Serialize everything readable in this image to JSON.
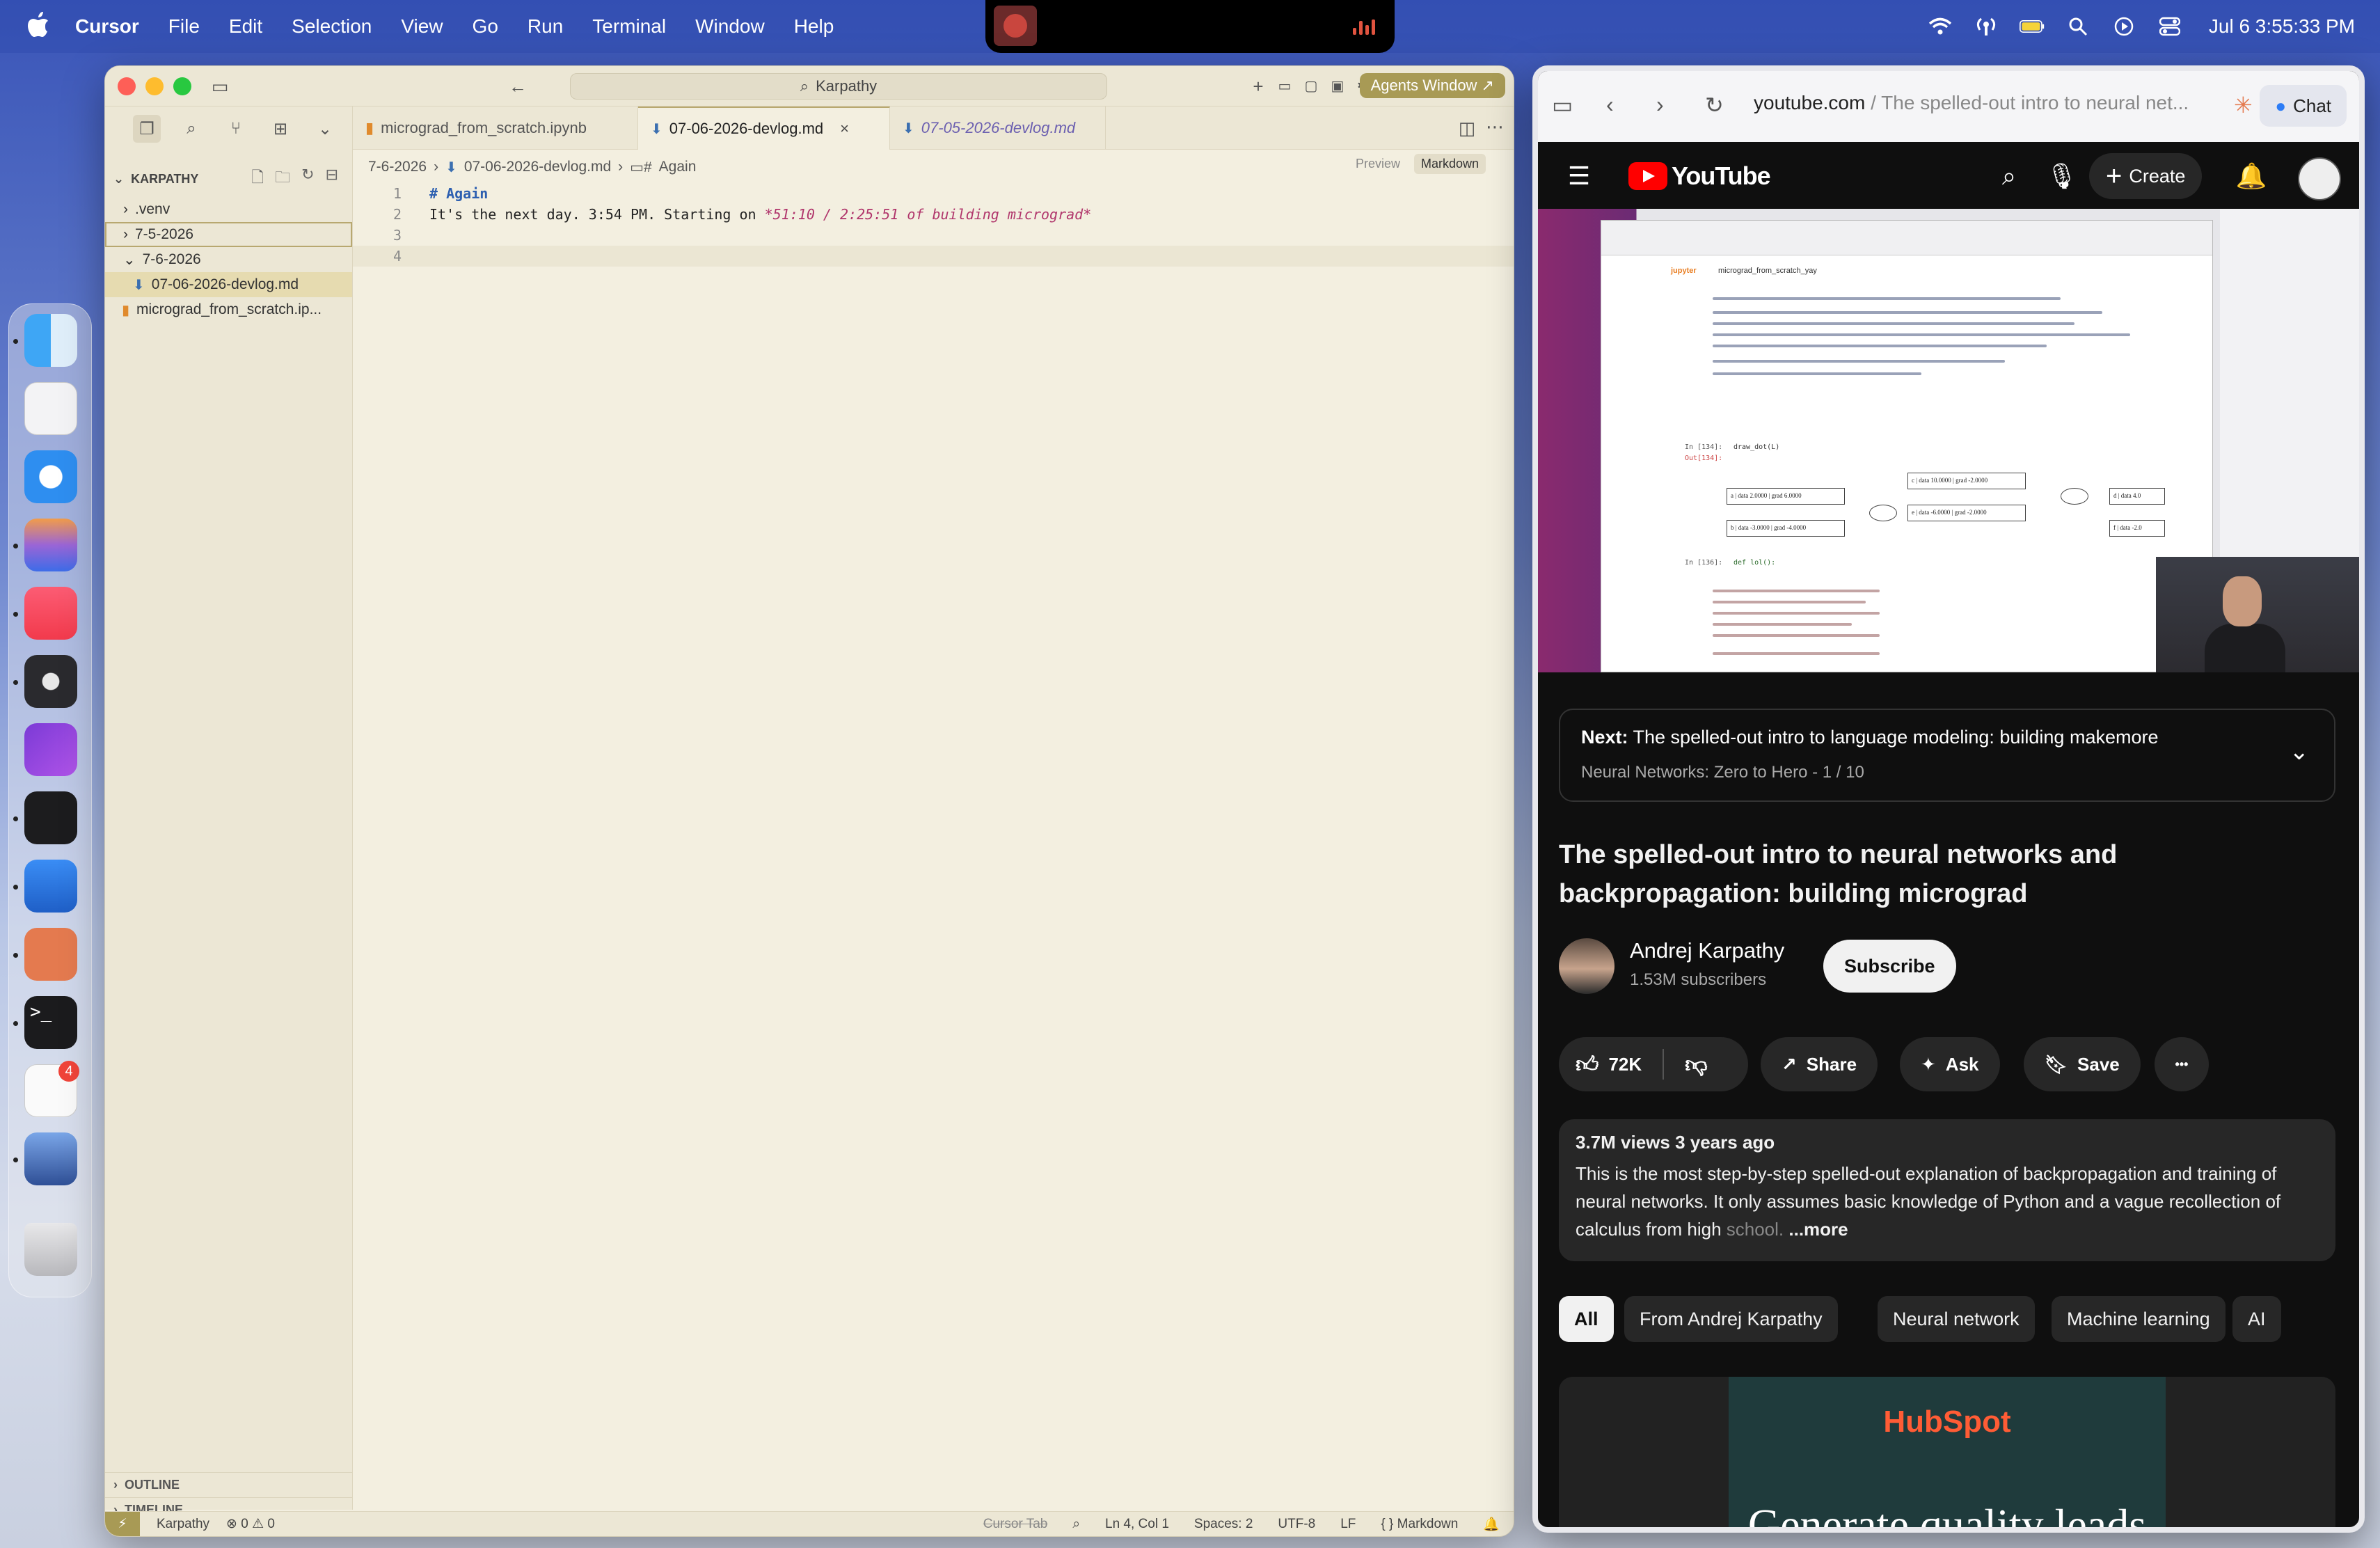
{
  "menubar": {
    "apple_icon": "apple-logo-icon",
    "items": [
      "Cursor",
      "File",
      "Edit",
      "Selection",
      "View",
      "Go",
      "Run",
      "Terminal",
      "Window",
      "Help"
    ],
    "clock": "Jul 6  3:55:33 PM",
    "status_icons": [
      "wifi-icon",
      "airdrop-icon",
      "battery-icon",
      "search-icon",
      "screen-record-icon",
      "control-center-icon"
    ]
  },
  "dock": {
    "apps": [
      "Finder",
      "Launchpad",
      "Safari",
      "Arc",
      "Music",
      "DaVinci Resolve",
      "Affinity Photo",
      "Cursor",
      "Xcode",
      "Claude",
      "Terminal",
      "Reminders",
      "Backup",
      "Trash"
    ],
    "reminders_badge": "4"
  },
  "editor": {
    "search_text": "Karpathy",
    "agents_label": "Agents Window ↗",
    "explorer": {
      "title": "KARPATHY",
      "rows": [
        {
          "label": ".venv",
          "chevron": "›"
        },
        {
          "label": "7-5-2026",
          "chevron": "›"
        },
        {
          "label": "7-6-2026",
          "chevron": "⌄"
        },
        {
          "label": "07-06-2026-devlog.md",
          "chevron": ""
        },
        {
          "label": "micrograd_from_scratch.ip...",
          "chevron": ""
        }
      ],
      "outline": "OUTLINE",
      "timeline": "TIMELINE"
    },
    "tabs": [
      {
        "label": "micrograd_from_scratch.ipynb"
      },
      {
        "label": "07-06-2026-devlog.md",
        "close": "×"
      },
      {
        "label": "07-05-2026-devlog.md"
      }
    ],
    "breadcrumb": {
      "folder": "7-6-2026",
      "file": "07-06-2026-devlog.md",
      "section": "Again"
    },
    "view_modes": {
      "preview": "Preview",
      "markdown": "Markdown"
    },
    "lines": [
      {
        "num": "1",
        "heading": "# Again"
      },
      {
        "num": "2",
        "plain": "It's the next day. 3:54 PM. Starting on ",
        "emph": "*51:10 / 2:25:51 of building micrograd*"
      },
      {
        "num": "3"
      },
      {
        "num": "4"
      }
    ],
    "status": {
      "workspace": "Karpathy",
      "problems": "⊗ 0 ⚠ 0",
      "cursor_tab": "Cursor Tab",
      "position": "Ln 4, Col 1",
      "spaces": "Spaces: 2",
      "encoding": "UTF-8",
      "eol": "LF",
      "language": "{ }  Markdown"
    }
  },
  "browser": {
    "url_domain": "youtube.com",
    "url_rest": " / The spelled-out intro to neural net...",
    "chat_label": "Chat",
    "youtube": {
      "logo_text": "YouTube",
      "create_label": "Create",
      "next_label": "Next:",
      "next_title": "The spelled-out intro to language modeling: building makemore",
      "next_playlist": "Neural Networks: Zero to Hero - 1 / 10",
      "title": "The spelled-out intro to neural networks and backpropagation: building micrograd",
      "channel": "Andrej Karpathy",
      "subscribers": "1.53M subscribers",
      "subscribe_label": "Subscribe",
      "likes": "72K",
      "share_label": "Share",
      "ask_label": "Ask",
      "save_label": "Save",
      "more_icon": "•••",
      "views_age": "3.7M views  3 years ago",
      "description": "This is the most step-by-step spelled-out explanation of backpropagation and training of neural networks. It only assumes basic knowledge of Python and a vague recollection of calculus from high ",
      "description_fade": "school.",
      "description_more": " ...more",
      "chips": [
        "All",
        "From Andrej Karpathy",
        "Neural network",
        "Machine learning",
        "AI"
      ],
      "ad_brand": "HubSpot",
      "ad_text": "Generate quality leads"
    },
    "video_notebook": {
      "app": "jupyter",
      "notebook": "micrograd_from_scratch_yay",
      "cell_labels": [
        "In [134]:",
        "Out[134]:",
        "In [136]:"
      ],
      "draw_call": "draw_dot(L)",
      "def_line": "def lol():",
      "nodes": [
        "a | data 2.0000 | grad 6.0000",
        "b | data -3.0000 | grad -4.0000",
        "c | data 10.0000 | grad -2.0000",
        "e | data -6.0000 | grad -2.0000",
        "d | data 4.0",
        "f | data -2.0"
      ]
    }
  }
}
